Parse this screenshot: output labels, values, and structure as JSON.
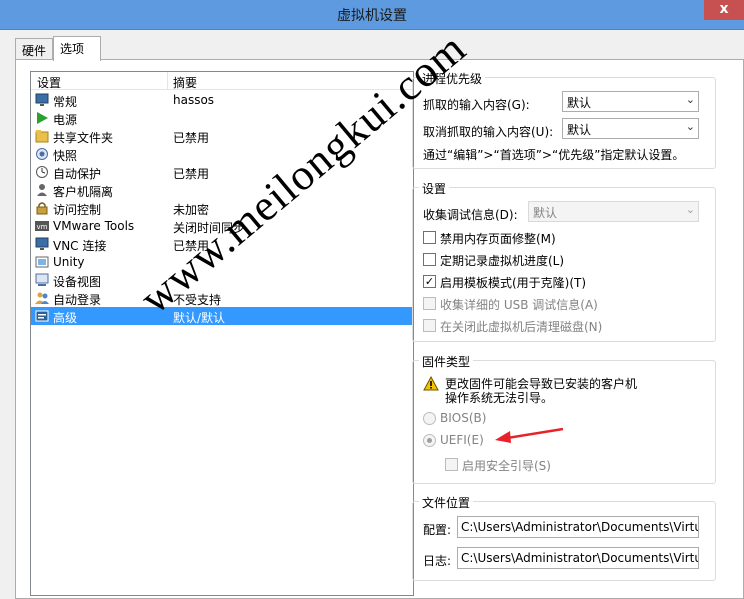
{
  "window": {
    "title": "虚拟机设置",
    "close_label": "x"
  },
  "tabs": [
    {
      "label": "硬件",
      "active": false
    },
    {
      "label": "选项",
      "active": true
    }
  ],
  "tree": {
    "headers": [
      "设置",
      "摘要"
    ],
    "rows": [
      {
        "name": "常规",
        "summary": "hassos",
        "icon": "monitor-icon"
      },
      {
        "name": "电源",
        "summary": "",
        "icon": "play-icon"
      },
      {
        "name": "共享文件夹",
        "summary": "已禁用",
        "icon": "folder-icon"
      },
      {
        "name": "快照",
        "summary": "",
        "icon": "camera-icon"
      },
      {
        "name": "自动保护",
        "summary": "已禁用",
        "icon": "clock-icon"
      },
      {
        "name": "客户机隔离",
        "summary": "",
        "icon": "user-icon"
      },
      {
        "name": "访问控制",
        "summary": "未加密",
        "icon": "lock-icon"
      },
      {
        "name": "VMware Tools",
        "summary": "关闭时间同步",
        "icon": "vm-icon"
      },
      {
        "name": "VNC 连接",
        "summary": "已禁用",
        "icon": "monitor-icon"
      },
      {
        "name": "Unity",
        "summary": "",
        "icon": "unity-icon"
      },
      {
        "name": "设备视图",
        "summary": "",
        "icon": "device-icon"
      },
      {
        "name": "自动登录",
        "summary": "不受支持",
        "icon": "users-icon"
      },
      {
        "name": "高级",
        "summary": "默认/默认",
        "icon": "advanced-icon",
        "selected": true
      }
    ]
  },
  "priority": {
    "title": "进程优先级",
    "grabbed_label": "抓取的输入内容(G):",
    "grabbed_value": "默认",
    "ungrabbed_label": "取消抓取的输入内容(U):",
    "ungrabbed_value": "默认",
    "note": "通过“编辑”>“首选项”>“优先级”指定默认设置。"
  },
  "settings": {
    "title": "设置",
    "debug_label": "收集调试信息(D):",
    "debug_value": "默认",
    "checkboxes": [
      {
        "label": "禁用内存页面修整(M)",
        "checked": false,
        "enabled": true
      },
      {
        "label": "定期记录虚拟机进度(L)",
        "checked": false,
        "enabled": true
      },
      {
        "label": "启用模板模式(用于克隆)(T)",
        "checked": true,
        "enabled": true
      },
      {
        "label": "收集详细的 USB 调试信息(A)",
        "checked": false,
        "enabled": false
      },
      {
        "label": "在关闭此虚拟机后清理磁盘(N)",
        "checked": false,
        "enabled": false
      }
    ]
  },
  "firmware": {
    "title": "固件类型",
    "warning": [
      "更改固件可能会导致已安装的客户机",
      "操作系统无法引导。"
    ],
    "bios_label": "BIOS(B)",
    "uefi_label": "UEFI(E)",
    "selected": "UEFI",
    "secure_boot_label": "启用安全引导(S)"
  },
  "files": {
    "title": "文件位置",
    "config_label": "配置:",
    "config_value": "C:\\Users\\Administrator\\Documents\\Virtual M",
    "log_label": "日志:",
    "log_value": "C:\\Users\\Administrator\\Documents\\Virtual M"
  },
  "watermark": "www.meilongkui.com",
  "colors": {
    "selection": "#3399ff",
    "title_bar": "#5d9adf",
    "close": "#c75050",
    "arrow": "#e8222a"
  }
}
